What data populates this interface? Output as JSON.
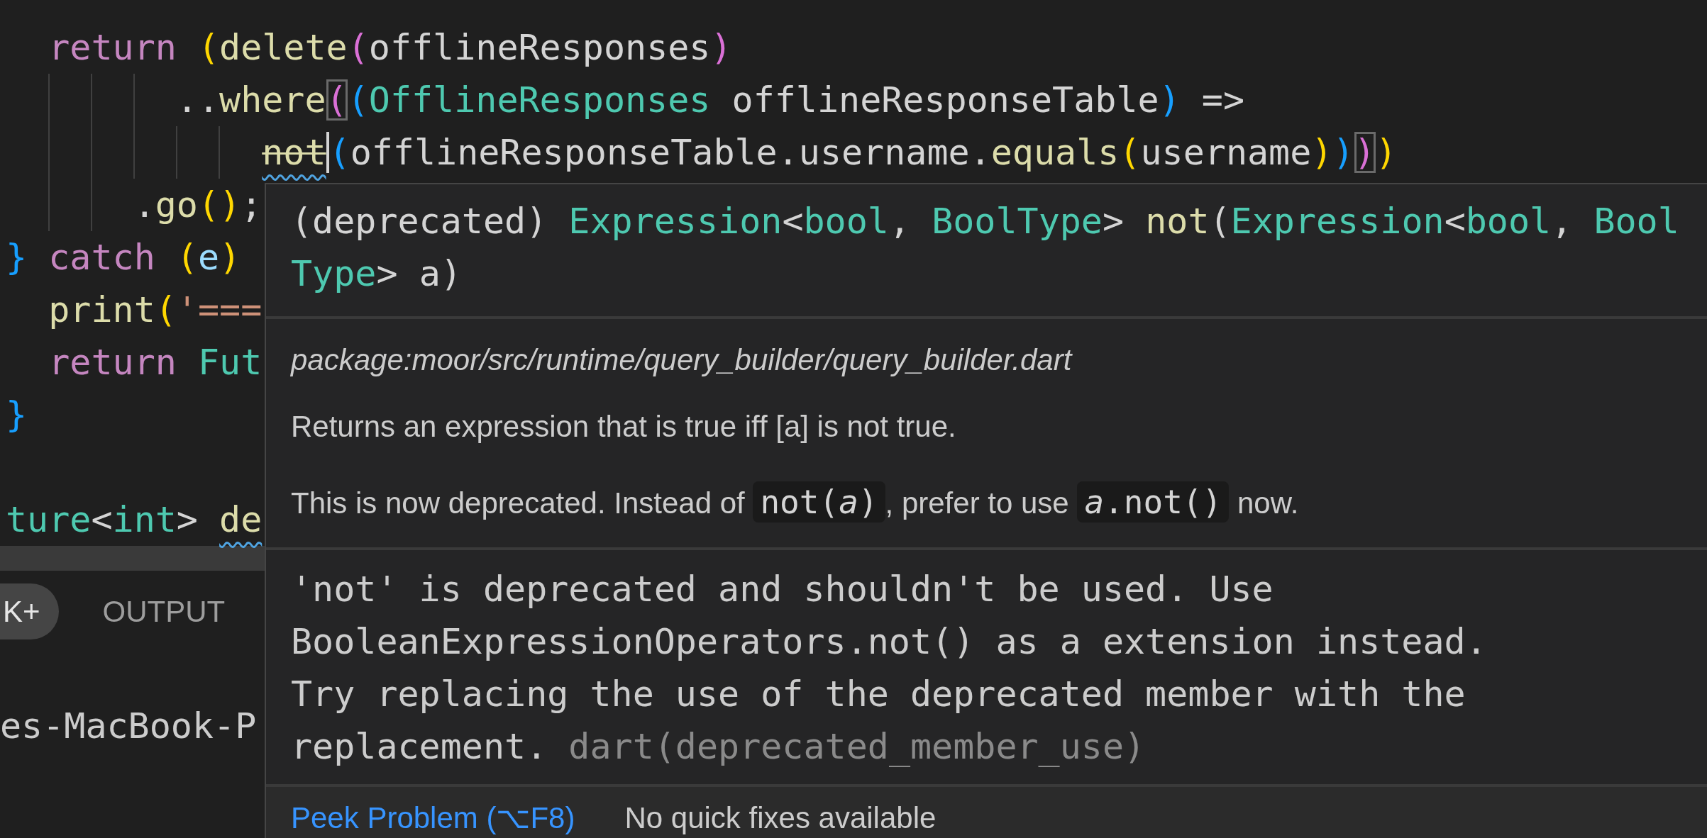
{
  "editor": {
    "lines": [
      {
        "tokens": [
          {
            "kind": "keyword",
            "text": "  return"
          },
          {
            "kind": "bracket1",
            "text": " ("
          },
          {
            "kind": "function",
            "text": "delete"
          },
          {
            "kind": "bracket2",
            "text": "("
          },
          {
            "kind": "variable",
            "text": "offlineResponses"
          },
          {
            "kind": "bracket2",
            "text": ")"
          }
        ]
      },
      {
        "tokens": [
          {
            "kind": "punct",
            "text": "        .."
          },
          {
            "kind": "function",
            "text": "where"
          },
          {
            "kind": "bracket2",
            "text": "(",
            "matched": true
          },
          {
            "kind": "bracket3",
            "text": "("
          },
          {
            "kind": "type",
            "text": "OfflineResponses"
          },
          {
            "kind": "variable",
            "text": " offlineResponseTable"
          },
          {
            "kind": "bracket3",
            "text": ")"
          },
          {
            "kind": "punct",
            "text": " =>"
          }
        ]
      },
      {
        "tokens": [
          {
            "kind": "function",
            "text": "            not",
            "deprecated": true,
            "squiggle": true,
            "cursor": true
          },
          {
            "kind": "bracket3",
            "text": "("
          },
          {
            "kind": "variable",
            "text": "offlineResponseTable.username."
          },
          {
            "kind": "function",
            "text": "equals"
          },
          {
            "kind": "bracket1",
            "text": "("
          },
          {
            "kind": "variable",
            "text": "username"
          },
          {
            "kind": "bracket1",
            "text": ")"
          },
          {
            "kind": "bracket3",
            "text": ")"
          },
          {
            "kind": "bracket2",
            "text": ")",
            "matched": true
          },
          {
            "kind": "bracket1",
            "text": ")"
          }
        ]
      },
      {
        "tokens": [
          {
            "kind": "punct",
            "text": "      ."
          },
          {
            "kind": "function",
            "text": "go"
          },
          {
            "kind": "bracket1",
            "text": "()"
          },
          {
            "kind": "punct",
            "text": ";"
          }
        ]
      },
      {
        "tokens": [
          {
            "kind": "bracket3",
            "text": "}"
          },
          {
            "kind": "keyword",
            "text": " catch"
          },
          {
            "kind": "bracket1",
            "text": " ("
          },
          {
            "kind": "param",
            "text": "e"
          },
          {
            "kind": "bracket1",
            "text": ")"
          }
        ]
      },
      {
        "tokens": [
          {
            "kind": "function",
            "text": "  print"
          },
          {
            "kind": "bracket1",
            "text": "("
          },
          {
            "kind": "string",
            "text": "'==="
          }
        ]
      },
      {
        "tokens": [
          {
            "kind": "keyword",
            "text": "  return"
          },
          {
            "kind": "type",
            "text": " Fut"
          }
        ]
      },
      {
        "tokens": [
          {
            "kind": "bracket3",
            "text": "}"
          }
        ]
      },
      {
        "kind": "blank"
      },
      {
        "tokens": [
          {
            "kind": "type",
            "text": "ture"
          },
          {
            "kind": "punct",
            "text": "<"
          },
          {
            "kind": "type",
            "text": "int"
          },
          {
            "kind": "punct",
            "text": "> "
          },
          {
            "kind": "function",
            "text": "de",
            "squiggle": true
          }
        ]
      }
    ]
  },
  "hover": {
    "signature": [
      {
        "kind": "punct",
        "text": "(deprecated) "
      },
      {
        "kind": "type",
        "text": "Expression"
      },
      {
        "kind": "punct",
        "text": "<"
      },
      {
        "kind": "type",
        "text": "bool"
      },
      {
        "kind": "punct",
        "text": ", "
      },
      {
        "kind": "type",
        "text": "BoolType"
      },
      {
        "kind": "punct",
        "text": "> "
      },
      {
        "kind": "function",
        "text": "not"
      },
      {
        "kind": "punct",
        "text": "("
      },
      {
        "kind": "type",
        "text": "Expression"
      },
      {
        "kind": "punct",
        "text": "<"
      },
      {
        "kind": "type",
        "text": "bool"
      },
      {
        "kind": "punct",
        "text": ", "
      },
      {
        "kind": "type",
        "text": "BoolType"
      },
      {
        "kind": "punct",
        "text": "> a)"
      }
    ],
    "source": "package:moor/src/runtime/query_builder/query_builder.dart",
    "paragraphs": [
      {
        "parts": [
          {
            "kind": "text",
            "text": "Returns an expression that is true iff [a] is not true."
          }
        ]
      },
      {
        "parts": [
          {
            "kind": "text",
            "text": "This is now deprecated. Instead of "
          },
          {
            "kind": "code",
            "text": "not(*a*)"
          },
          {
            "kind": "text",
            "text": ", prefer to use "
          },
          {
            "kind": "code",
            "text": "*a*.not()"
          },
          {
            "kind": "text",
            "text": " now."
          }
        ]
      }
    ],
    "problem": {
      "message": "'not' is deprecated and shouldn't be used. Use BooleanExpressionOperators.not() as a extension instead.\nTry replacing the use of the deprecated member with the replacement.",
      "code": "dart(deprecated_member_use)"
    },
    "actions": [
      {
        "kind": "link",
        "label": "Peek Problem (⌥F8)"
      },
      {
        "kind": "note",
        "label": "No quick fixes available"
      }
    ]
  },
  "panel": {
    "badge": "K+",
    "tabs": [
      {
        "label": "OUTPUT",
        "selected": false
      }
    ],
    "terminal": "es-MacBook-P"
  }
}
